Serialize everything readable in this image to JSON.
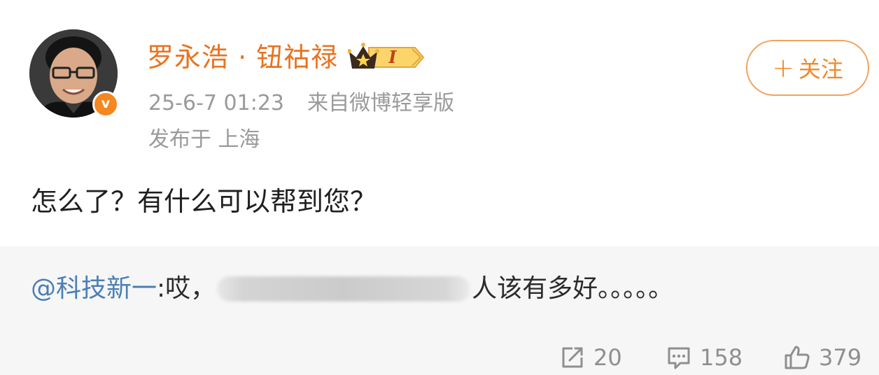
{
  "post": {
    "username": "罗永浩 · 钮祜禄",
    "vip_level": "I",
    "verified_badge": "v",
    "timestamp": "25-6-7 01:23",
    "source": "来自微博轻享版",
    "location": "发布于 上海",
    "follow_label": "关注",
    "follow_plus": "+",
    "content": "怎么了？有什么可以帮到您？"
  },
  "retweet": {
    "mention": "@科技新一",
    "text_before": ":哎，",
    "text_after": "人该有多好。。。。。"
  },
  "actions": {
    "repost_count": "20",
    "comment_count": "158",
    "like_count": "379"
  },
  "colors": {
    "username": "#e8731f",
    "accent": "#f08a2a",
    "mention": "#4b7fb5",
    "muted": "#9a9a9a",
    "retweet_bg": "#f6f6f6"
  },
  "icons": {
    "repost": "repost-icon",
    "comment": "comment-icon",
    "like": "thumbs-up-icon",
    "vip": "crown-icon"
  }
}
